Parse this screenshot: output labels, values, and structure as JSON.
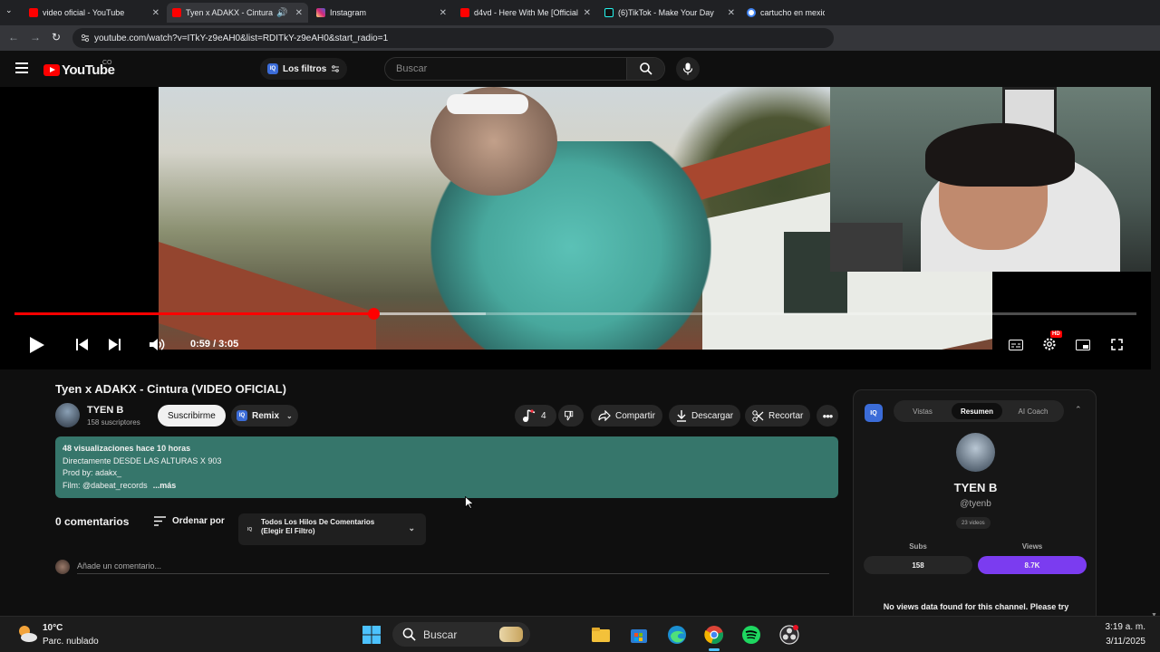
{
  "browser": {
    "tabs": [
      {
        "title": "video oficial - YouTube",
        "favicon_color": "#ff0000"
      },
      {
        "title": "Tyen x ADAKX - Cintura (VI",
        "favicon_color": "#ff0000",
        "active": true
      },
      {
        "title": "Instagram",
        "favicon_color": "#d6249f"
      },
      {
        "title": "d4vd - Here With Me [Official M",
        "favicon_color": "#ff0000"
      },
      {
        "title": "(6)TikTok - Make Your Day",
        "favicon_color": "#111111"
      },
      {
        "title": "cartucho en mexico -",
        "favicon_color": "#4285f4"
      }
    ],
    "url": "youtube.com/watch?v=ITkY-z9eAH0&list=RDITkY-z9eAH0&start_radio=1"
  },
  "header": {
    "logo_text": "YouTube",
    "country_code": "CO",
    "filters_label": "Los filtros",
    "search_placeholder": "Buscar"
  },
  "player": {
    "current_time": "0:59 / 3:05",
    "progress_fraction": 0.32,
    "buffered_fraction": 0.42,
    "hd_badge": "HD"
  },
  "video": {
    "title": "Tyen x ADAKX - Cintura (VIDEO OFICIAL)",
    "channel_name": "TYEN B",
    "channel_subs": "158 suscriptores",
    "subscribe_label": "Suscribirme",
    "remix_label": "Remix",
    "likes": "4",
    "share_label": "Compartir",
    "download_label": "Descargar",
    "clip_label": "Recortar"
  },
  "description": {
    "meta": "48 visualizaciones  hace 10 horas",
    "line1": "Directamente DESDE LAS ALTURAS X 903",
    "line2": "Prod by: adakx_",
    "line3": "Film: @dabeat_records",
    "more": "...más"
  },
  "comments": {
    "count_label": "0 comentarios",
    "sort_label": "Ordenar por",
    "filter_iq": "IQ",
    "filter_line1": "Todos Los Hilos De Comentarios",
    "filter_line2": "(Elegir El Filtro)",
    "input_placeholder": "Añade un comentario..."
  },
  "iq_panel": {
    "logo": "IQ",
    "tabs": [
      "Vistas",
      "Resumen",
      "AI Coach"
    ],
    "active_tab": "Resumen",
    "channel_name": "TYEN B",
    "handle": "@tyenb",
    "videos_count": "23 videos",
    "subs_label": "Subs",
    "subs_value": "158",
    "views_label": "Views",
    "views_value": "8.7K",
    "message": "No views data found for this channel. Please try again later."
  },
  "taskbar": {
    "temperature": "10°C",
    "weather": "Parc. nublado",
    "search_label": "Buscar",
    "time": "3:19 a. m.",
    "date": "3/11/2025"
  },
  "colors": {
    "accent_red": "#ff0000",
    "description_bg": "#36766b",
    "views_button": "#7b3cf0",
    "iq_blue": "#3b6cd8"
  }
}
